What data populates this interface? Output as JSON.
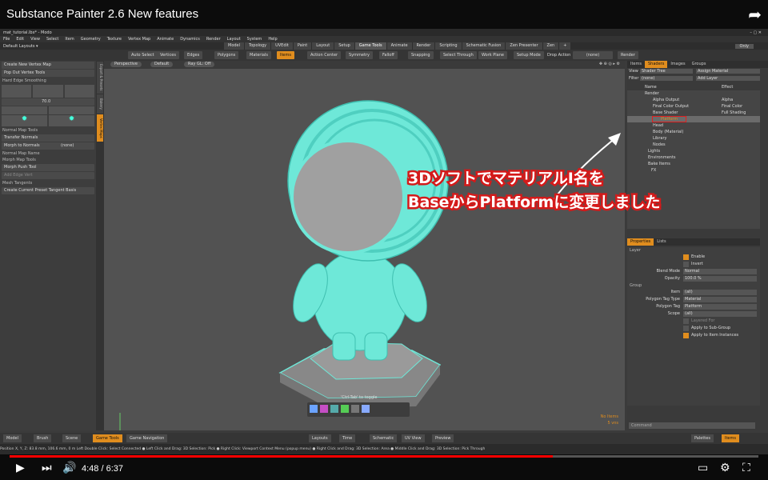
{
  "video": {
    "title": "Substance Painter 2.6 New features",
    "time": "4:48 / 6:37",
    "progress": 0.725
  },
  "app": {
    "window_title": "mat_tutorial.lbx* - Modo",
    "menus": [
      "File",
      "Edit",
      "View",
      "Select",
      "Item",
      "Geometry",
      "Texture",
      "Vertex Map",
      "Animate",
      "Dynamics",
      "Render",
      "Layout",
      "System",
      "Help"
    ],
    "layout_label": "Default Layouts ▾",
    "tabs": [
      "Model",
      "Topology",
      "UVEdit",
      "Paint",
      "Layout",
      "Setup",
      "Game Tools",
      "Animate",
      "Render",
      "Scripting",
      "Schematic Fusion",
      "Zen Presenter",
      "Zen",
      "+"
    ],
    "only": "Only",
    "toolbar": [
      "Auto Select",
      "Vertices",
      "Edges",
      "Polygons",
      "Materials",
      "Items",
      "Action Center",
      "Symmetry",
      "Falloff",
      "Snapping",
      "Select Through",
      "Work Plane",
      "Setup Mode",
      "Drop Action",
      "(none)",
      "Render"
    ],
    "left": {
      "rows": [
        "Create New Vertex Map",
        "Pop Out Vertex Tools",
        "Hard Edge Smoothing",
        "70.0",
        "Normal Map Tools",
        "Transfer Normals",
        "Morph to Normals",
        "(none)",
        "Normal Map Name",
        "Morph Map Tools",
        "Morph Push Tool",
        "Add Edge Vert",
        "Mesh Tangents",
        "Create Current Preset Tangent Basis"
      ]
    },
    "vtabs": [
      "Export & Presets",
      "Bakery",
      "Vertex Maps"
    ],
    "viewport": {
      "buttons": [
        "Perspective",
        "Default",
        "Ray GL: Off"
      ],
      "toggle_hint": "'Ctrl-Tab' to toggle",
      "no_items": "No Items",
      "items_count": "5 vns"
    },
    "right": {
      "tabs": [
        "Items",
        "Shaders",
        "Images",
        "Groups"
      ],
      "view_label": "View",
      "view_value": "Shader Tree",
      "assign": "Assign Material",
      "filter_label": "Filter",
      "filter_value": "(none)",
      "add_layer": "Add Layer",
      "col_name": "Name",
      "col_effect": "Effect",
      "tree": [
        {
          "name": "Render",
          "effect": ""
        },
        {
          "name": "Alpha Output",
          "effect": "Alpha"
        },
        {
          "name": "Final Color Output",
          "effect": "Final Color"
        },
        {
          "name": "Base Shader",
          "effect": "Full Shading"
        },
        {
          "name": "Platform",
          "effect": ""
        },
        {
          "name": "Head",
          "effect": ""
        },
        {
          "name": "Body (Material)",
          "effect": ""
        },
        {
          "name": "Library",
          "effect": ""
        },
        {
          "name": "Nodes",
          "effect": ""
        },
        {
          "name": "Lights",
          "effect": ""
        },
        {
          "name": "Environments",
          "effect": ""
        },
        {
          "name": "Bake Items",
          "effect": ""
        },
        {
          "name": "FX",
          "effect": ""
        }
      ],
      "props_tabs": [
        "Properties",
        "Lists"
      ],
      "layer_head": "Layer",
      "enable": "Enable",
      "invert": "Invert",
      "blend_label": "Blend Mode",
      "blend": "Normal",
      "opacity_label": "Opacity",
      "opacity": "100.0 %",
      "group_head": "Group",
      "item_label": "Item",
      "item": "(all)",
      "ptt_label": "Polygon Tag Type",
      "ptt": "Material",
      "pt_label": "Polygon Tag",
      "pt": "Platform",
      "scope_label": "Scope",
      "scope": "(all)",
      "layered": "Layered For",
      "apply_sub": "Apply to Sub-Group",
      "apply_inst": "Apply to Item Instances",
      "command": "Command"
    },
    "bottom": [
      "Model",
      "Brush",
      "Scene",
      "Game Tools",
      "Game Navigation",
      "Layouts",
      "Time",
      "Schematic",
      "UV View",
      "Preview",
      "Palettes",
      "Items"
    ],
    "status": "Position X, Y, Z:  83.8 mm, 106.6 mm, 0 m          Left Double Click: Select Connected ● Left Click and Drag: 3D Selection: Pick ● Right Click: Viewport Context Menu (popup menu) ● Right Click and Drag: 3D Selection: Area ● Middle Click and Drag: 3D Selection: Pick Through"
  },
  "annotation": {
    "line1": "3DソフトでマテリアルI名を",
    "line2": "BaseからPlatformに変更しました"
  },
  "colors": {
    "accent": "#e08d1e",
    "highlight": "#e02020",
    "model": "#6ee8d8"
  }
}
